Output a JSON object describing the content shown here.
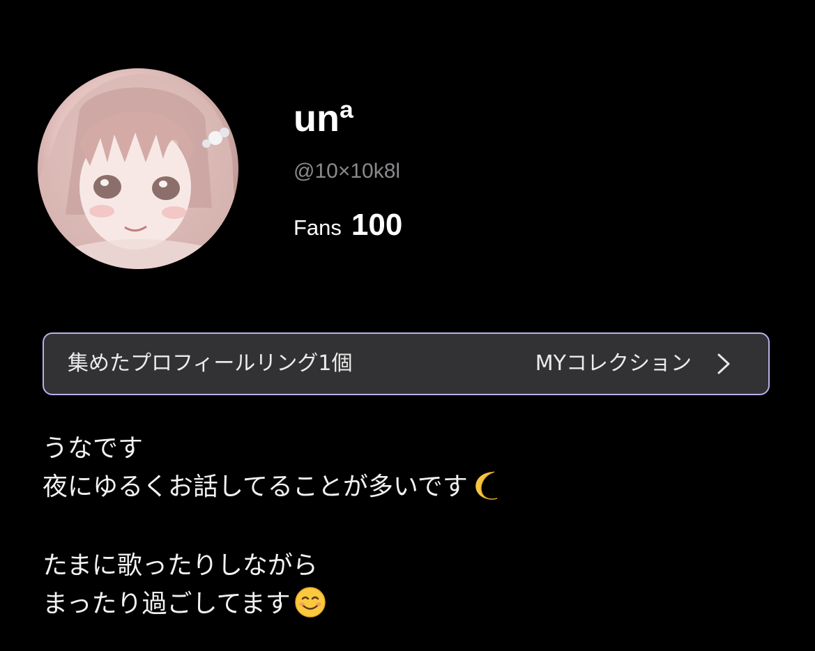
{
  "profile": {
    "display_name": "unª",
    "handle": "@10×10k8l",
    "fans_label": "Fans",
    "fans_count": "100",
    "avatar": "avatar-anime-illustration"
  },
  "collection_bar": {
    "ring_count_text": "集めたプロフィールリング1個",
    "link_label": "MYコレクション",
    "chevron_icon": "chevron-right-icon",
    "border_color": "#b7b2ec",
    "background_color": "#323234"
  },
  "bio": {
    "line1": "うなです",
    "line2": "夜にゆるくお話してることが多いです",
    "line2_emoji": "crescent-moon-icon",
    "line3": "たまに歌ったりしながら",
    "line4": "まったり過ごしてます",
    "line4_emoji": "smiling-face-icon"
  }
}
